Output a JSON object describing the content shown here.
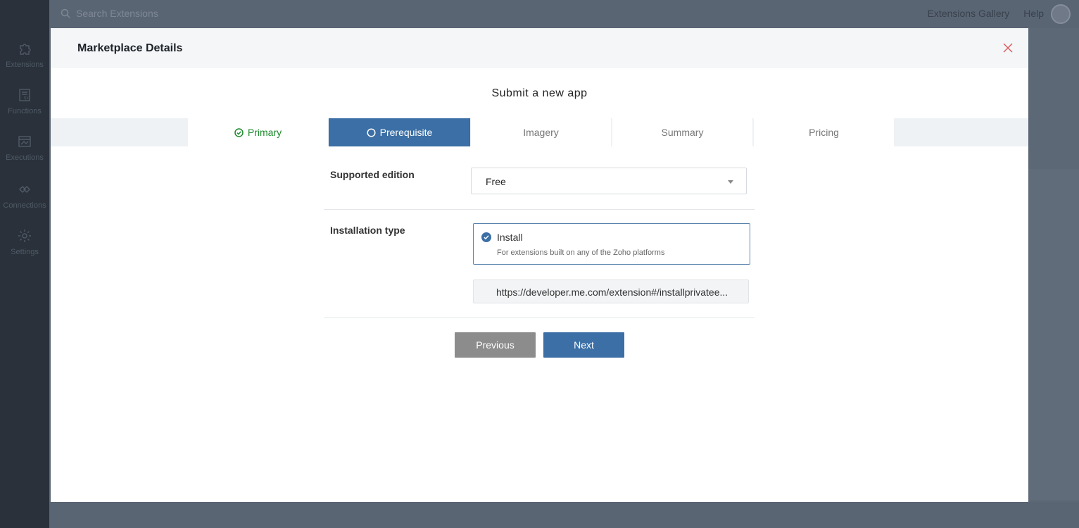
{
  "sidebar": {
    "items": [
      {
        "label": "Extensions",
        "icon": "puzzle-icon"
      },
      {
        "label": "Functions",
        "icon": "function-icon"
      },
      {
        "label": "Executions",
        "icon": "executions-icon"
      },
      {
        "label": "Connections",
        "icon": "connections-icon"
      },
      {
        "label": "Settings",
        "icon": "gear-icon"
      }
    ]
  },
  "topbar": {
    "search_placeholder": "Search Extensions",
    "gallery_link": "Extensions Gallery",
    "help_link": "Help"
  },
  "modal": {
    "title": "Marketplace Details",
    "subtitle": "Submit a new app",
    "steps": [
      {
        "label": "Primary",
        "state": "done"
      },
      {
        "label": "Prerequisite",
        "state": "active"
      },
      {
        "label": "Imagery",
        "state": "pending"
      },
      {
        "label": "Summary",
        "state": "pending"
      },
      {
        "label": "Pricing",
        "state": "pending"
      }
    ],
    "supported_edition": {
      "label": "Supported edition",
      "value": "Free"
    },
    "installation_type": {
      "label": "Installation type",
      "option_title": "Install",
      "option_desc": "For extensions built on any of the Zoho platforms",
      "url": "https://developer.me.com/extension#/installprivatee..."
    },
    "buttons": {
      "previous": "Previous",
      "next": "Next"
    }
  },
  "colors": {
    "accent": "#3b6fa5",
    "success": "#1c8a2c",
    "close": "#e05a5a"
  }
}
